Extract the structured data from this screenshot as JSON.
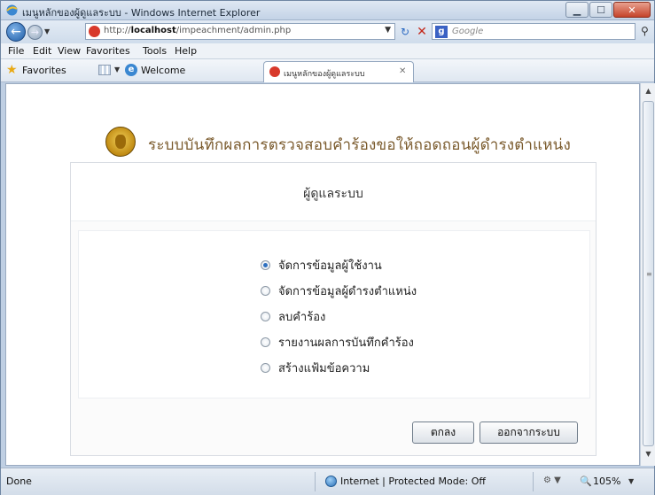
{
  "window": {
    "title": "เมนูหลักของผู้ดูแลระบบ - Windows Internet Explorer",
    "controls": {
      "minimize": "▁",
      "maximize": "☐",
      "close": "✕"
    }
  },
  "address": {
    "url_prefix": "http://",
    "url_host": "localhost",
    "url_path": "/impeachment/admin.php",
    "search_placeholder": "Google",
    "search_provider_glyph": "g"
  },
  "menu": [
    "File",
    "Edit",
    "View",
    "Favorites",
    "Tools",
    "Help"
  ],
  "favorites": {
    "label": "Favorites",
    "welcome": "Welcome",
    "tab_label": "เมนูหลักของผู้ดูแลระบบ"
  },
  "page": {
    "site_title": "ระบบบันทึกผลการตรวจสอบคำร้องขอให้ถอดถอนผู้ดำรงตำแหน่ง",
    "panel_title": "ผู้ดูแลระบบ",
    "options": [
      {
        "label": "จัดการข้อมูลผู้ใช้งาน",
        "checked": true
      },
      {
        "label": "จัดการข้อมูลผู้ดำรงตำแหน่ง",
        "checked": false
      },
      {
        "label": "ลบคำร้อง",
        "checked": false
      },
      {
        "label": "รายงานผลการบันทึกคำร้อง",
        "checked": false
      },
      {
        "label": "สร้างแฟ้มข้อความ",
        "checked": false
      }
    ],
    "buttons": {
      "ok": "ตกลง",
      "logout": "ออกจากระบบ"
    }
  },
  "status": {
    "left": "Done",
    "zone": "Internet | Protected Mode: Off",
    "zoom": "105%"
  },
  "icons": {
    "back": "back-arrow-icon",
    "forward": "forward-arrow-icon",
    "refresh": "refresh-icon",
    "stop": "stop-icon",
    "favorites": "favorites-star-icon",
    "seal": "emblem-seal-icon"
  }
}
